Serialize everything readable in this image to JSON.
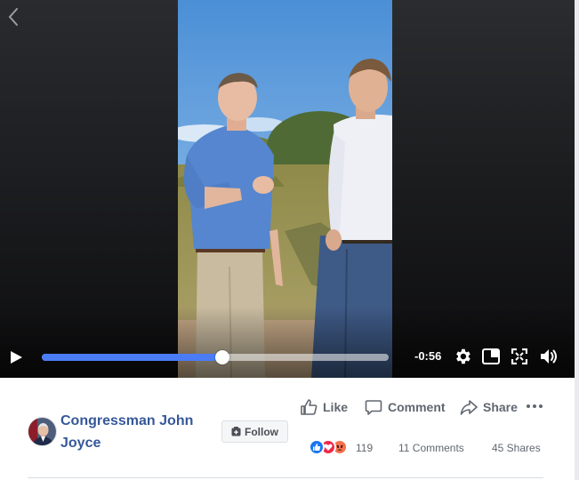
{
  "video": {
    "time_remaining": "-0:56",
    "progress_fraction": 0.52
  },
  "post": {
    "page_name": "Congressman John Joyce",
    "follow_label": "Follow"
  },
  "actions": {
    "like_label": "Like",
    "comment_label": "Comment",
    "share_label": "Share"
  },
  "stats": {
    "reaction_count": "119",
    "comments": "11 Comments",
    "shares": "45 Shares"
  },
  "icons": {
    "back": "chevron-left-icon",
    "play": "play-icon",
    "settings": "gear-icon",
    "pip": "picture-in-picture-icon",
    "fullscreen": "fullscreen-icon",
    "volume": "volume-icon",
    "follow": "follow-icon",
    "like": "thumbs-up-icon",
    "comment": "comment-bubble-icon",
    "share": "share-arrow-icon",
    "more": "more-dots-icon",
    "reactions": [
      "like-reaction-icon",
      "love-reaction-icon",
      "angry-reaction-icon"
    ]
  },
  "colors": {
    "progress": "#4a7cf6",
    "page_name": "#365899",
    "action_text": "#606770",
    "like_reaction": "#1877f2",
    "love_reaction": "#f0284a",
    "angry_reaction": "#f7714c"
  }
}
